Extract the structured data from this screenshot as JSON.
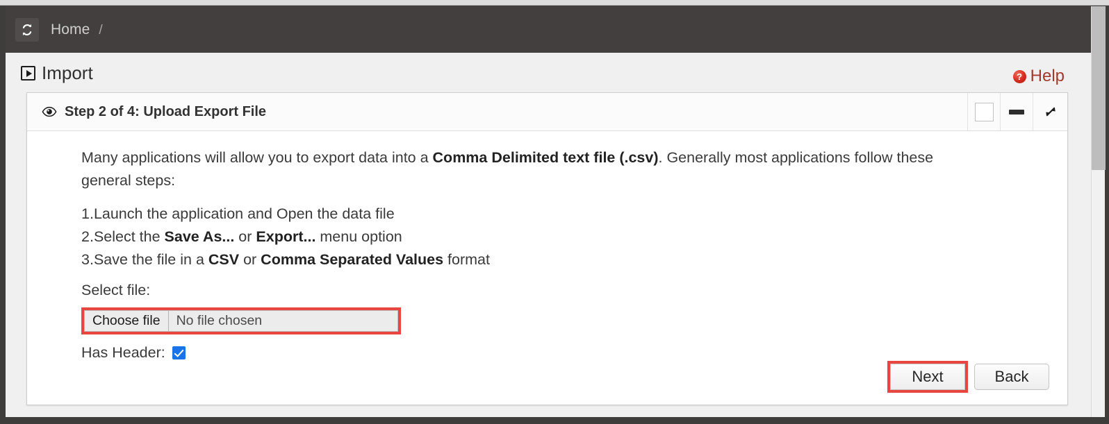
{
  "window": {
    "accent_red": "#e8473f",
    "navbar_bg": "#423f3e",
    "page_bg": "#f0f0f0"
  },
  "navbar": {
    "logo_icon": "refresh-sync-icon",
    "breadcrumb": {
      "home_label": "Home",
      "separator": "/"
    }
  },
  "page_header": {
    "icon": "import-play-icon",
    "title": "Import",
    "help": {
      "icon": "help-question-icon",
      "label": "Help"
    }
  },
  "panel": {
    "header": {
      "icon": "eye-icon",
      "title": "Step 2 of 4: Upload Export File",
      "controls": [
        {
          "name": "restore-button",
          "icon": "square-icon"
        },
        {
          "name": "minimize-button",
          "icon": "dash-icon"
        },
        {
          "name": "expand-button",
          "icon": "diagonal-arrows-icon"
        }
      ]
    },
    "body": {
      "intro": {
        "part1": "Many applications will allow you to export data into a ",
        "bold1": "Comma Delimited text file (.csv)",
        "part2": ". Generally most applications follow these general steps:"
      },
      "steps": [
        {
          "number": "1.",
          "text_a": "Launch the application and Open the data file",
          "bold_a": "",
          "text_b": "",
          "bold_b": "",
          "text_c": ""
        },
        {
          "number": "2.",
          "text_a": "Select the ",
          "bold_a": "Save As...",
          "text_b": " or ",
          "bold_b": "Export...",
          "text_c": " menu option"
        },
        {
          "number": "3.",
          "text_a": "Save the file in a ",
          "bold_a": "CSV",
          "text_b": " or ",
          "bold_b": "Comma Separated Values",
          "text_c": " format"
        }
      ],
      "select_file_label": "Select file:",
      "file_input": {
        "button_label": "Choose file",
        "status_text": "No file chosen",
        "highlighted": true
      },
      "has_header": {
        "label": "Has Header:",
        "checked": true
      }
    },
    "footer": {
      "next_label": "Next",
      "back_label": "Back",
      "next_highlighted": true
    }
  },
  "scrollbar": {
    "thumb_top": 0,
    "thumb_height": 236
  }
}
